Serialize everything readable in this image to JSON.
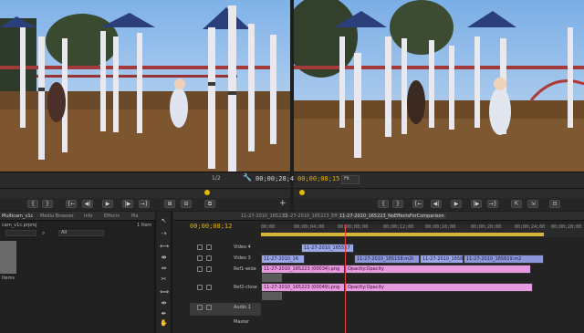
{
  "source_monitor": {
    "page": "1/2",
    "timecode": "00;00;28;43",
    "transport": [
      "{",
      "}",
      "{←",
      "◀|",
      "▶",
      "|▶",
      "→}",
      "⊞",
      "⊟",
      "⧉"
    ]
  },
  "program_monitor": {
    "timecode": "00;00;08;15",
    "fit": "Fit",
    "transport": [
      "{",
      "}",
      "{←",
      "◀|",
      "▶",
      "|▶",
      "→}",
      "⇱",
      "⇲",
      "⊡"
    ]
  },
  "project_panel": {
    "tabs": [
      "Multicam_v1c",
      "Media Browser",
      "Info",
      "Effects",
      "Ma"
    ],
    "filename": "cam_v1c.prproj",
    "item_count": "1 Item",
    "filter": "All",
    "list_item": "Items"
  },
  "timeline": {
    "tabs": [
      "11-27-2010_165223",
      "11-27-2010_165223_EffectsApplied",
      "11-27-2010_165223_NoEffectsForComparison"
    ],
    "timecode": "00;00;08;12",
    "ruler": [
      "00;00",
      "00;00;04;00",
      "00;00;08;00",
      "00;00;12;00",
      "00;00;16;00",
      "00;00;20;00",
      "00;00;24;00",
      "00;00;28;00"
    ],
    "tracks": [
      {
        "name": "Video 4"
      },
      {
        "name": "Video 3"
      },
      {
        "name": "Ref1-wide"
      },
      {
        "name": "Ref2-close"
      },
      {
        "name": "Audio 1"
      },
      {
        "name": "Master"
      }
    ],
    "clips": {
      "v4": "11-27-2010_165557",
      "v3": [
        "11-27-2010_16",
        "11-27-2010_165158.m2t",
        "11-27-2010_1658",
        "11-27-2010_165619.m2"
      ],
      "ref1_a": "11-27-2010_165223 (00034).png",
      "ref1_b": "Opacity:Opacity",
      "ref2_a": "11-27-2010_165223 (00049).png",
      "ref2_b": "Opacity:Opacity"
    }
  },
  "colors": {
    "timecode": "#e8b400",
    "playhead": "#e0423a",
    "clip_blue": "#9aa6e8",
    "clip_pink": "#e89ae0"
  }
}
